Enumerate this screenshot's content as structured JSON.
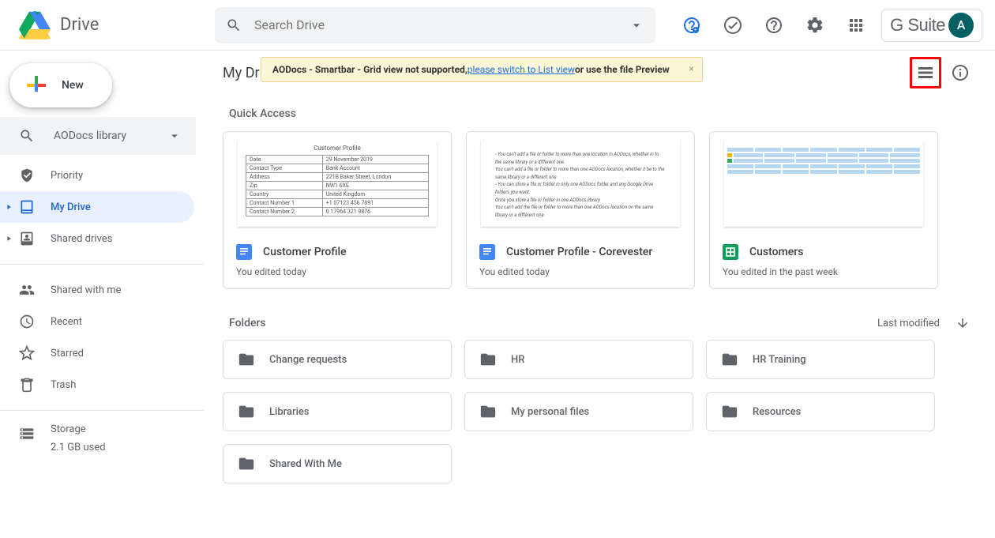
{
  "header": {
    "app_name": "Drive",
    "search_placeholder": "Search Drive",
    "gsuite_label": "G Suite",
    "avatar_initial": "A"
  },
  "banner": {
    "prefix": "AODocs - Smartbar - Grid view not supported, ",
    "link": "please switch to List view",
    "suffix": " or use the file Preview"
  },
  "sidebar": {
    "new_label": "New",
    "library_label": "AODocs library",
    "nav": {
      "priority": "Priority",
      "mydrive": "My Drive",
      "shared_drives": "Shared drives",
      "shared_with_me": "Shared with me",
      "recent": "Recent",
      "starred": "Starred",
      "trash": "Trash"
    },
    "storage": {
      "title": "Storage",
      "used": "2.1 GB used"
    }
  },
  "main": {
    "path": "My Drive",
    "quick_access_h": "Quick Access",
    "folders_h": "Folders",
    "sort_label": "Last modified",
    "qa": [
      {
        "title": "Customer Profile",
        "sub": "You edited today"
      },
      {
        "title": "Customer Profile - Corevester",
        "sub": "You edited today"
      },
      {
        "title": "Customers",
        "sub": "You edited in the past week"
      }
    ],
    "folders": [
      "Change requests",
      "HR",
      "HR Training",
      "Libraries",
      "My personal files",
      "Resources",
      "Shared With Me"
    ]
  }
}
